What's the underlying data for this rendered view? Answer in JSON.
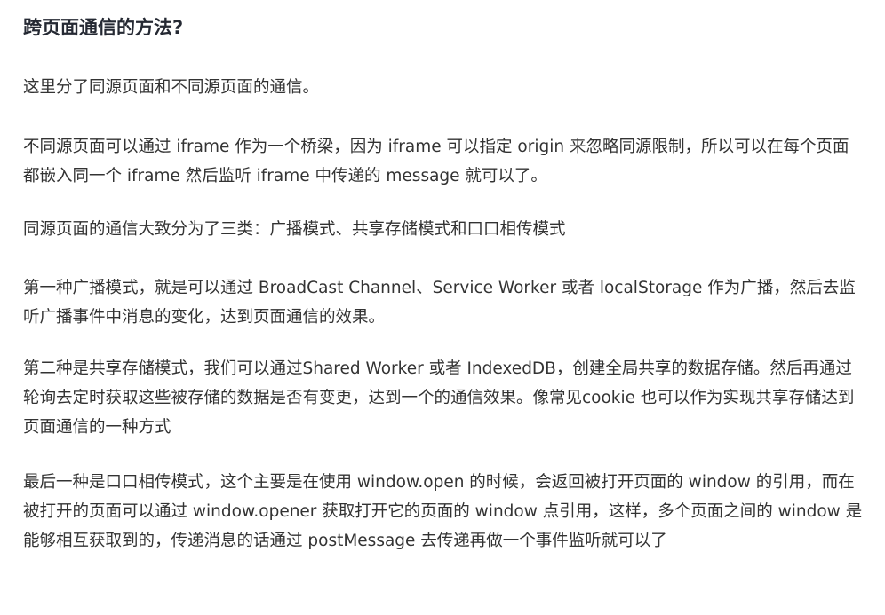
{
  "article": {
    "title": "跨页面通信的方法?",
    "paragraphs": [
      "这里分了同源页面和不同源页面的通信。",
      "不同源页面可以通过 iframe 作为一个桥梁，因为 iframe 可以指定 origin 来忽略同源限制，所以可以在每个页面都嵌入同一个 iframe 然后监听 iframe 中传递的 message 就可以了。",
      "同源页面的通信大致分为了三类：广播模式、共享存储模式和口口相传模式",
      "第一种广播模式，就是可以通过 BroadCast Channel、Service Worker 或者 localStorage 作为广播，然后去监听广播事件中消息的变化，达到页面通信的效果。",
      "第二种是共享存储模式，我们可以通过Shared Worker 或者 IndexedDB，创建全局共享的数据存储。然后再通过轮询去定时获取这些被存储的数据是否有变更，达到一个的通信效果。像常见cookie 也可以作为实现共享存储达到页面通信的一种方式",
      "最后一种是口口相传模式，这个主要是在使用 window.open 的时候，会返回被打开页面的 window 的引用，而在被打开的页面可以通过 window.opener 获取打开它的页面的 window 点引用，这样，多个页面之间的 window 是能够相互获取到的，传递消息的话通过 postMessage 去传递再做一个事件监听就可以了"
    ]
  }
}
